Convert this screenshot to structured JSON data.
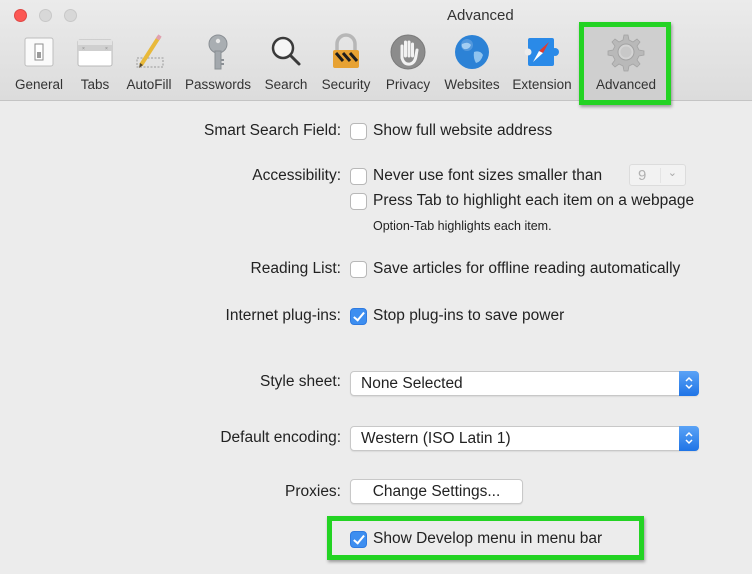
{
  "window": {
    "title": "Advanced",
    "controls": [
      "close",
      "minimize",
      "zoom"
    ]
  },
  "toolbar": {
    "items": [
      {
        "label": "General",
        "icon": "general-switch-icon"
      },
      {
        "label": "Tabs",
        "icon": "tabs-window-icon"
      },
      {
        "label": "AutoFill",
        "icon": "pencil-form-icon"
      },
      {
        "label": "Passwords",
        "icon": "key-icon"
      },
      {
        "label": "Search",
        "icon": "magnifier-icon"
      },
      {
        "label": "Security",
        "icon": "padlock-icon"
      },
      {
        "label": "Privacy",
        "icon": "hand-stop-icon"
      },
      {
        "label": "Websites",
        "icon": "globe-icon"
      },
      {
        "label": "Extension",
        "icon": "puzzle-compass-icon"
      },
      {
        "label": "Advanced",
        "icon": "gear-icon"
      }
    ],
    "selected": "Advanced"
  },
  "settings": {
    "smart_search": {
      "label": "Smart Search Field:",
      "option": "Show full website address",
      "checked": false
    },
    "accessibility": {
      "label": "Accessibility:",
      "min_font": {
        "option": "Never use font sizes smaller than",
        "checked": false,
        "value": "9"
      },
      "tab_highlight": {
        "option": "Press Tab to highlight each item on a webpage",
        "checked": false
      },
      "hint": "Option-Tab highlights each item."
    },
    "reading_list": {
      "label": "Reading List:",
      "option": "Save articles for offline reading automatically",
      "checked": false
    },
    "plugins": {
      "label": "Internet plug-ins:",
      "option": "Stop plug-ins to save power",
      "checked": true
    },
    "style_sheet": {
      "label": "Style sheet:",
      "value": "None Selected"
    },
    "encoding": {
      "label": "Default encoding:",
      "value": "Western (ISO Latin 1)"
    },
    "proxies": {
      "label": "Proxies:",
      "button": "Change Settings..."
    },
    "develop_menu": {
      "option": "Show Develop menu in menu bar",
      "checked": true
    }
  },
  "colors": {
    "highlight": "#23d323",
    "accent": "#3d8ef0",
    "close_button": "#fc5753"
  }
}
